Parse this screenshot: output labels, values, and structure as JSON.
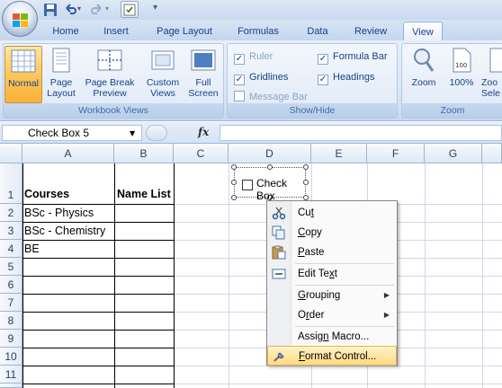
{
  "qat": {
    "icons": [
      "save-icon",
      "undo-icon",
      "redo-icon",
      "customize-icon",
      "more-icon"
    ]
  },
  "tabs": [
    {
      "label": "Home"
    },
    {
      "label": "Insert"
    },
    {
      "label": "Page Layout"
    },
    {
      "label": "Formulas"
    },
    {
      "label": "Data"
    },
    {
      "label": "Review"
    },
    {
      "label": "View",
      "active": true
    }
  ],
  "ribbon": {
    "workbook_views": {
      "label": "Workbook Views",
      "normal": "Normal",
      "page_layout_1": "Page",
      "page_layout_2": "Layout",
      "page_break_1": "Page Break",
      "page_break_2": "Preview",
      "custom_1": "Custom",
      "custom_2": "Views",
      "full_1": "Full",
      "full_2": "Screen"
    },
    "show_hide": {
      "label": "Show/Hide",
      "ruler": "Ruler",
      "formula_bar": "Formula Bar",
      "gridlines": "Gridlines",
      "headings": "Headings",
      "message_bar": "Message Bar"
    },
    "zoom": {
      "label": "Zoom",
      "zoom": "Zoom",
      "hundred": "100%",
      "zoom_sel_1": "Zoo",
      "zoom_sel_2": "Sele",
      "page_icon_text": "100"
    }
  },
  "formula_bar": {
    "name_box": "Check Box 5",
    "fx": "fx",
    "value": ""
  },
  "grid": {
    "columns": [
      "A",
      "B",
      "C",
      "D",
      "E",
      "F",
      "G"
    ],
    "rows": [
      "1",
      "2",
      "3",
      "4",
      "5",
      "6",
      "7",
      "8",
      "9",
      "10",
      "11"
    ],
    "cells": {
      "A1": "Courses",
      "B1": "Name List",
      "A2": "BSc - Physics",
      "A3": "BSc - Chemistry",
      "A4": "BE"
    }
  },
  "checkbox_control": {
    "label": "Check Box"
  },
  "context_menu": {
    "items": [
      {
        "label": "Cut",
        "pre": "Cu",
        "acc": "t",
        "post": "",
        "icon": "scissors-icon"
      },
      {
        "label": "Copy",
        "pre": "",
        "acc": "C",
        "post": "opy",
        "icon": "copy-icon"
      },
      {
        "label": "Paste",
        "pre": "",
        "acc": "P",
        "post": "aste",
        "icon": "paste-icon"
      },
      {
        "label": "Edit Text",
        "pre": "Edit Te",
        "acc": "x",
        "post": "t",
        "icon": "edit-text-icon"
      },
      {
        "label": "Grouping",
        "pre": "",
        "acc": "G",
        "post": "rouping",
        "submenu": true
      },
      {
        "label": "Order",
        "pre": "O",
        "acc": "r",
        "post": "der",
        "submenu": true
      },
      {
        "label": "Assign Macro...",
        "pre": "Assig",
        "acc": "n",
        "post": " Macro...",
        "icon": ""
      },
      {
        "label": "Format Control...",
        "pre": "",
        "acc": "F",
        "post": "ormat Control...",
        "icon": "format-control-icon",
        "highlighted": true
      }
    ]
  },
  "colors": {
    "ribbon_text": "#15428b",
    "menu_highlight": "#ffd980",
    "selected_button": "#fbc75a"
  }
}
